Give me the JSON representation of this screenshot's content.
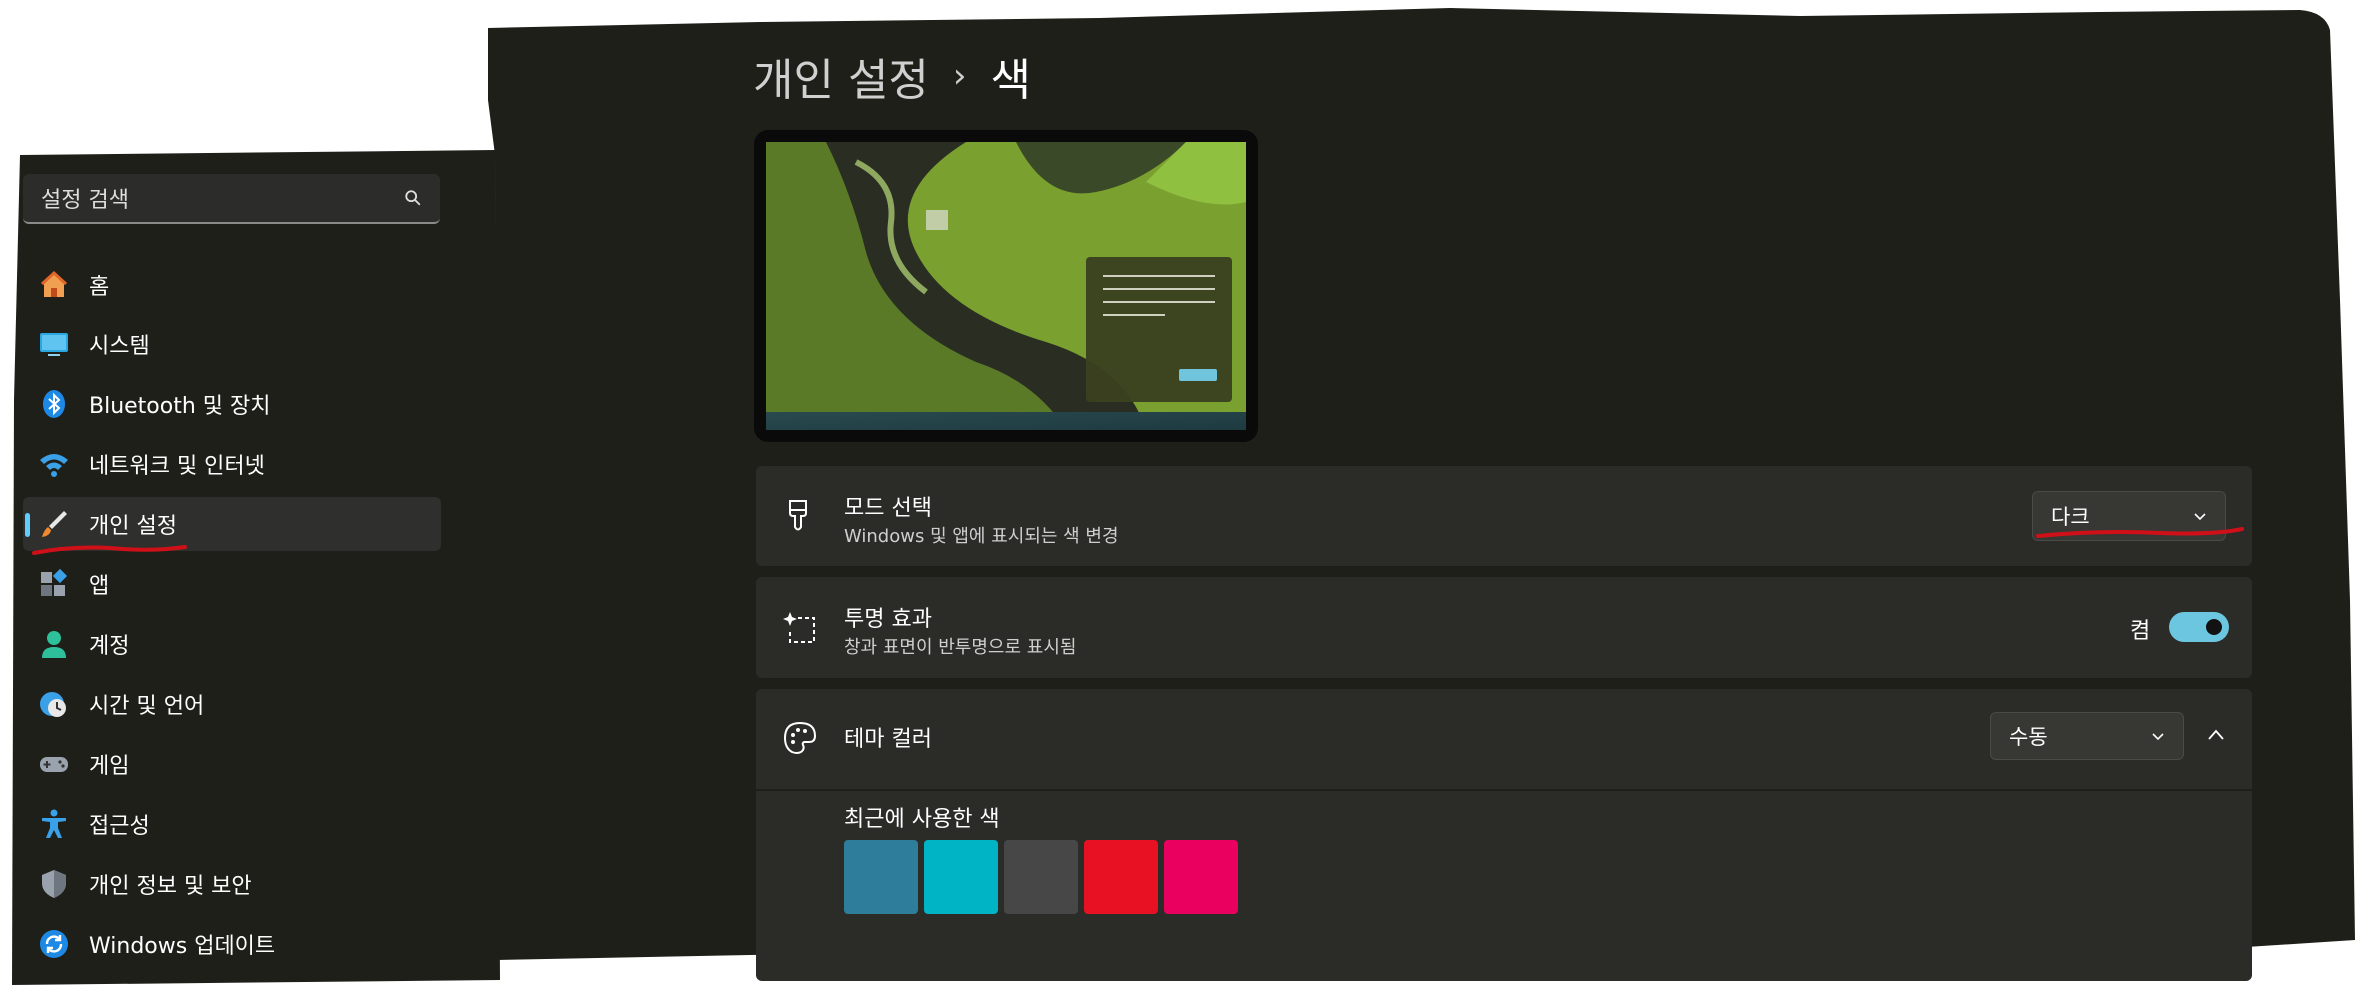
{
  "sidebar": {
    "search_placeholder": "설정 검색",
    "items": [
      {
        "label": "홈",
        "icon": "home-icon"
      },
      {
        "label": "시스템",
        "icon": "system-icon"
      },
      {
        "label": "Bluetooth 및 장치",
        "icon": "bluetooth-icon"
      },
      {
        "label": "네트워크 및 인터넷",
        "icon": "wifi-icon"
      },
      {
        "label": "개인 설정",
        "icon": "brush-icon",
        "selected": true
      },
      {
        "label": "앱",
        "icon": "apps-icon"
      },
      {
        "label": "계정",
        "icon": "account-icon"
      },
      {
        "label": "시간 및 언어",
        "icon": "time-language-icon"
      },
      {
        "label": "게임",
        "icon": "gamepad-icon"
      },
      {
        "label": "접근성",
        "icon": "accessibility-icon"
      },
      {
        "label": "개인 정보 및 보안",
        "icon": "shield-icon"
      },
      {
        "label": "Windows 업데이트",
        "icon": "update-icon"
      }
    ]
  },
  "header": {
    "parent": "개인 설정",
    "separator": "›",
    "current": "색"
  },
  "mode": {
    "title": "모드 선택",
    "description": "Windows 및 앱에 표시되는 색 변경",
    "value": "다크"
  },
  "transparency": {
    "title": "투명 효과",
    "description": "창과 표면이 반투명으로 표시됨",
    "state_label": "켬",
    "on": true
  },
  "theme_color": {
    "title": "테마 컬러",
    "value": "수동",
    "recent_label": "최근에 사용한 색",
    "recent_colors": [
      "#2e7d9b",
      "#00b4c6",
      "#474747",
      "#e81123",
      "#ea005e"
    ]
  },
  "colors": {
    "accent": "#60cdff",
    "toggle_on": "#6cc6e0",
    "background": "#1f1f1a",
    "card": "#2b2b28"
  }
}
